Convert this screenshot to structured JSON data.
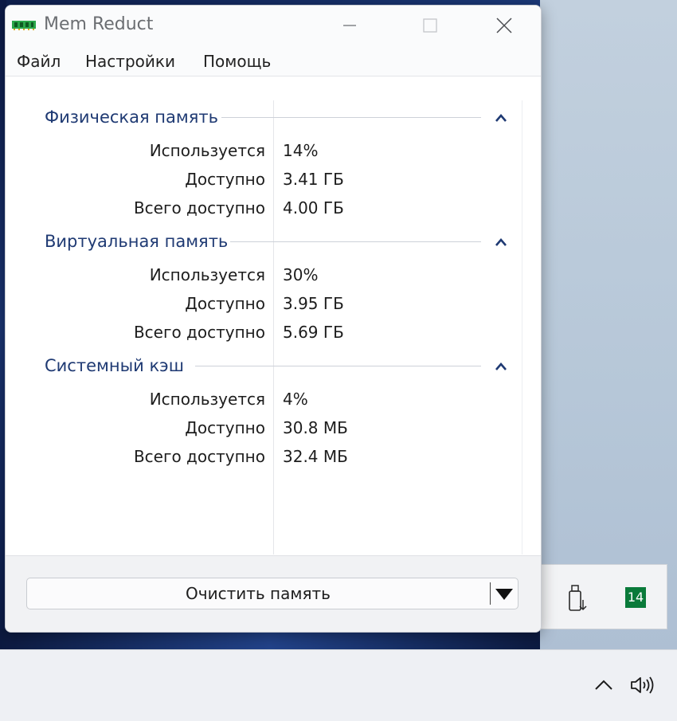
{
  "window": {
    "title": "Mem Reduct"
  },
  "menu": {
    "file": "Файл",
    "settings": "Настройки",
    "help": "Помощь"
  },
  "groups": [
    {
      "title": "Физическая память",
      "rows": [
        {
          "label": "Используется",
          "value": "14%"
        },
        {
          "label": "Доступно",
          "value": "3.41 ГБ"
        },
        {
          "label": "Всего доступно",
          "value": "4.00 ГБ"
        }
      ]
    },
    {
      "title": "Виртуальная память",
      "rows": [
        {
          "label": "Используется",
          "value": "30%"
        },
        {
          "label": "Доступно",
          "value": "3.95 ГБ"
        },
        {
          "label": "Всего доступно",
          "value": "5.69 ГБ"
        }
      ]
    },
    {
      "title": "Системный кэш",
      "rows": [
        {
          "label": "Используется",
          "value": "4%"
        },
        {
          "label": "Доступно",
          "value": "30.8 МБ"
        },
        {
          "label": "Всего доступно",
          "value": "32.4 МБ"
        }
      ]
    }
  ],
  "footer": {
    "clean_button": "Очистить память"
  },
  "tray": {
    "memreduct_value": "14",
    "memreduct_color": "#0a7a3a"
  },
  "colors": {
    "group_title": "#1f3a73",
    "accent_chevron": "#1f3a73"
  }
}
